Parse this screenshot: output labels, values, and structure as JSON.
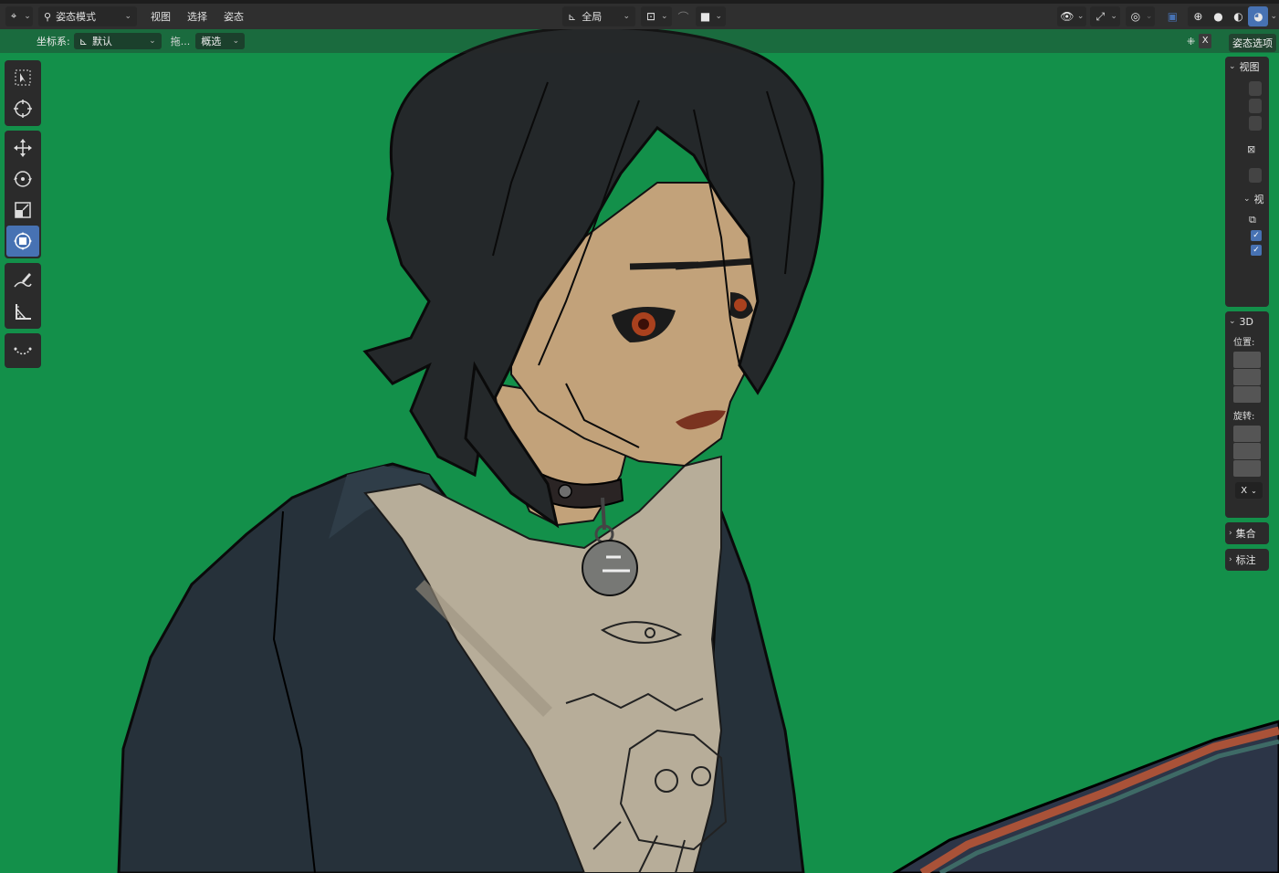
{
  "header": {
    "mode": "姿态模式",
    "menus": [
      "视图",
      "选择",
      "姿态"
    ],
    "transform_orientation": "全局"
  },
  "tool_settings": {
    "orientation_label": "坐标系:",
    "orientation_value": "默认",
    "drag_label": "拖...",
    "select_mode": "概选",
    "pose_options": "姿态选项",
    "axis_x": "X"
  },
  "left_tools": [
    {
      "name": "select-box-icon",
      "active": false
    },
    {
      "name": "cursor-icon",
      "active": false
    },
    {
      "name": "move-icon",
      "active": false
    },
    {
      "name": "rotate-icon",
      "active": false
    },
    {
      "name": "scale-icon",
      "active": false
    },
    {
      "name": "transform-icon",
      "active": true
    },
    {
      "name": "annotate-icon",
      "active": false
    },
    {
      "name": "measure-icon",
      "active": false
    },
    {
      "name": "relax-icon",
      "active": false
    }
  ],
  "sidebar": {
    "view_panel": "视图",
    "view_sub": "视",
    "panel_3d": "3D",
    "location_label": "位置:",
    "rotation_label": "旋转:",
    "rotation_mode": "X",
    "collection": "集合",
    "annotation": "标注"
  },
  "colors": {
    "background": "#13904a",
    "accent": "#4772b3"
  }
}
